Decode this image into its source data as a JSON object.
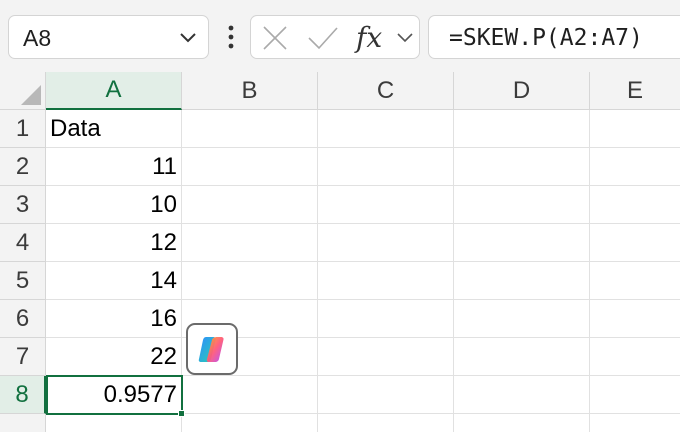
{
  "formula_bar": {
    "name_box": "A8",
    "fx_label": "fx",
    "formula": "=SKEW.P(A2:A7)"
  },
  "columns": [
    "A",
    "B",
    "C",
    "D",
    "E"
  ],
  "rows": [
    "1",
    "2",
    "3",
    "4",
    "5",
    "6",
    "7",
    "8"
  ],
  "cells": {
    "A1": "Data",
    "A2": "11",
    "A3": "10",
    "A4": "12",
    "A5": "14",
    "A6": "16",
    "A7": "22",
    "A8": "0.9577"
  },
  "selection": {
    "active_cell": "A8",
    "column": "A",
    "row": "8"
  },
  "colors": {
    "accent": "#11703f",
    "header_bg": "#f3f3f3",
    "selected_header_bg": "#e2eee7"
  },
  "icons": {
    "name_box_dropdown": "chevron-down-icon",
    "more_options": "kebab-icon",
    "cancel": "x-icon",
    "enter": "check-icon",
    "insert_function": "fx-icon",
    "copilot": "copilot-icon"
  }
}
